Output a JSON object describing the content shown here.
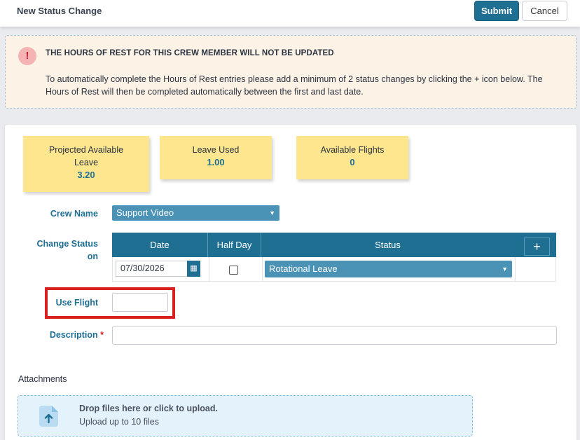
{
  "header": {
    "title": "New Status Change",
    "submit_label": "Submit",
    "cancel_label": "Cancel"
  },
  "alert": {
    "icon": "!",
    "title": "THE HOURS OF REST FOR THIS CREW MEMBER WILL NOT BE UPDATED",
    "body": "To automatically complete the Hours of Rest entries please add a minimum of 2 status changes by clicking the + icon below. The Hours of Rest will then be completed automatically between the first and last date."
  },
  "stats": [
    {
      "label": "Projected Available Leave",
      "value": "3.20"
    },
    {
      "label": "Leave Used",
      "value": "1.00"
    },
    {
      "label": "Available Flights",
      "value": "0"
    }
  ],
  "form": {
    "crew_name_label": "Crew Name",
    "crew_name_value": "Support Video",
    "change_status_label": "Change Status on",
    "table_headers": {
      "date": "Date",
      "half_day": "Half Day",
      "status": "Status"
    },
    "add_label": "+",
    "row": {
      "date": "07/30/2026",
      "half_day": false,
      "status": "Rotational Leave"
    },
    "use_flight_label": "Use Flight",
    "use_flight_value": "",
    "description_label": "Description",
    "required_marker": "*",
    "description_value": ""
  },
  "attachments": {
    "title": "Attachments",
    "drop_title": "Drop files here or click to upload.",
    "drop_sub": "Upload up to 10 files"
  },
  "colors": {
    "primary": "#1f6f93",
    "select": "#4a92b6",
    "stat_card": "#fde68e",
    "alert_bg": "#fdf2e6",
    "highlight": "#d8201f"
  }
}
